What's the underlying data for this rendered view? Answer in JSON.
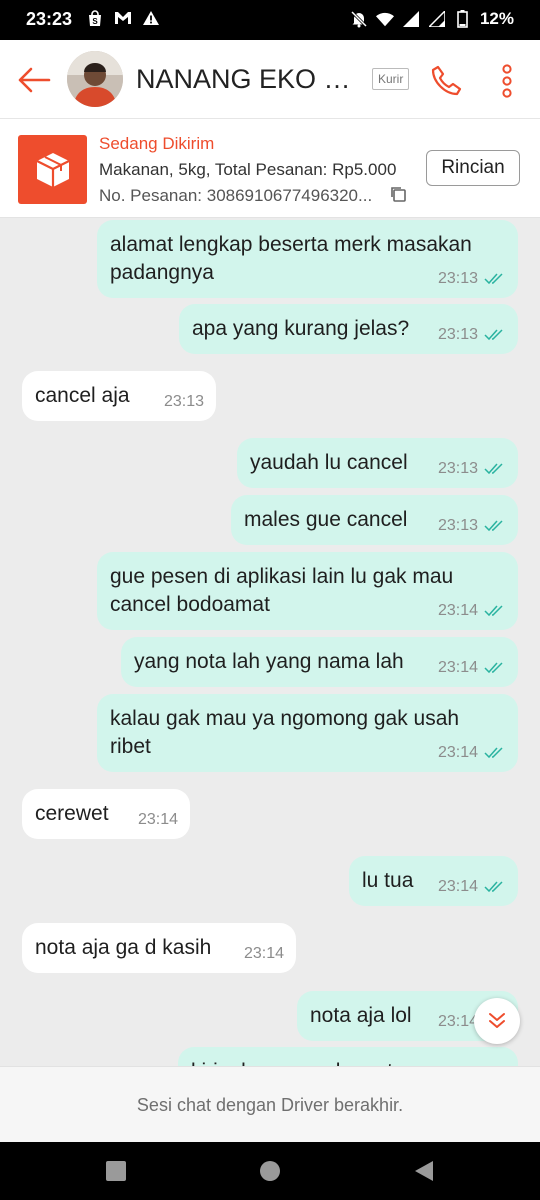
{
  "status_bar": {
    "time": "23:23",
    "battery": "12%",
    "left_icons": [
      "shopee-bag-icon",
      "gmail-icon",
      "warning-icon"
    ],
    "right_icons": [
      "mute-icon",
      "wifi-icon",
      "signal-icon",
      "signal-icon",
      "battery-icon"
    ]
  },
  "header": {
    "contact_name": "NANANG EKO P...",
    "role_badge": "Kurir"
  },
  "order": {
    "status": "Sedang Dikirim",
    "description": "Makanan, 5kg, Total Pesanan: Rp5.000",
    "order_number": "No. Pesanan: 3086910677496320...",
    "details_button": "Rincian"
  },
  "messages": [
    {
      "side": "out",
      "lines": [
        "alamat lengkap beserta merk masakan",
        "padangnya"
      ],
      "time": "23:13",
      "read": true
    },
    {
      "side": "out",
      "lines": [
        "apa yang kurang jelas?"
      ],
      "time": "23:13",
      "read": true
    },
    {
      "side": "in",
      "lines": [
        "cancel aja"
      ],
      "time": "23:13"
    },
    {
      "side": "out",
      "lines": [
        "yaudah lu cancel"
      ],
      "time": "23:13",
      "read": true
    },
    {
      "side": "out",
      "lines": [
        "males gue cancel"
      ],
      "time": "23:13",
      "read": true
    },
    {
      "side": "out",
      "lines": [
        "gue pesen di aplikasi lain lu gak mau",
        "cancel bodoamat"
      ],
      "time": "23:14",
      "read": true
    },
    {
      "side": "out",
      "lines": [
        "yang nota lah yang nama lah"
      ],
      "time": "23:14",
      "read": true
    },
    {
      "side": "out",
      "lines": [
        "kalau gak mau ya ngomong gak usah",
        "ribet"
      ],
      "time": "23:14",
      "read": true
    },
    {
      "side": "in",
      "lines": [
        "cerewet"
      ],
      "time": "23:14"
    },
    {
      "side": "out",
      "lines": [
        "lu tua"
      ],
      "time": "23:14",
      "read": true
    },
    {
      "side": "in",
      "lines": [
        "nota aja ga d kasih"
      ],
      "time": "23:14"
    },
    {
      "side": "out",
      "lines": [
        "nota aja lol"
      ],
      "time": "23:14",
      "read": true
    },
    {
      "side": "out",
      "lines": [
        "kirim barang pake nota"
      ],
      "time": "",
      "read": false
    }
  ],
  "chat_ended": "Sesi chat dengan Driver berakhir.",
  "colors": {
    "accent": "#ee4d2d",
    "outgoing_bubble": "#d2f5ec",
    "incoming_bubble": "#ffffff",
    "read_tick": "#2ab3a0",
    "chat_background": "#ececec"
  }
}
